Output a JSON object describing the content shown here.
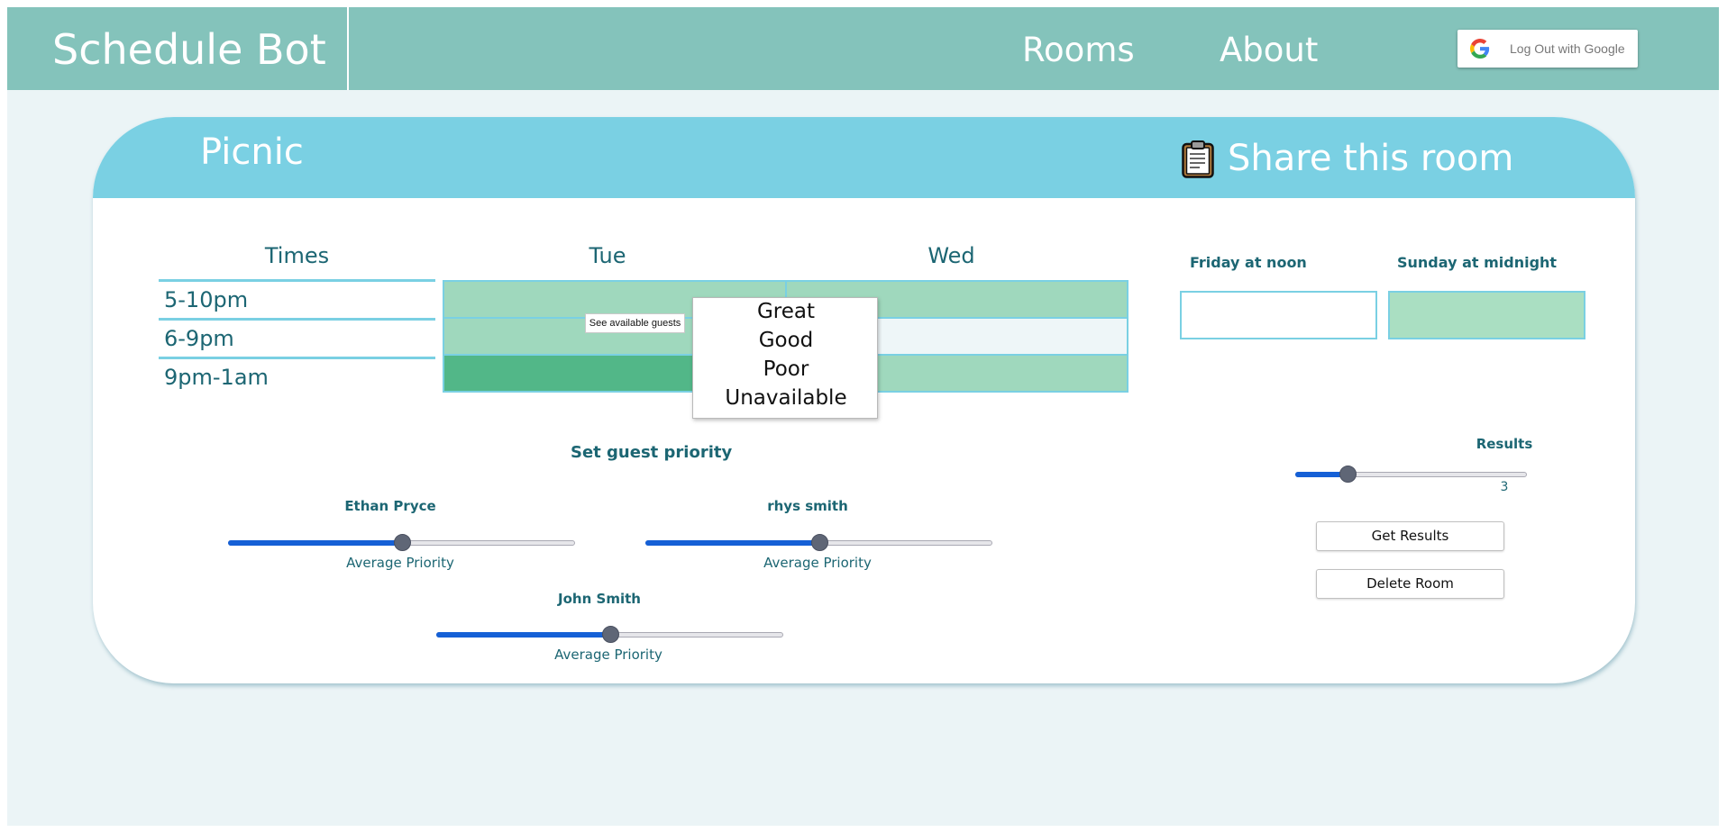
{
  "nav": {
    "brand": "Schedule Bot",
    "links": [
      "Rooms",
      "About"
    ],
    "google_button": "Log Out with Google"
  },
  "room": {
    "title": "Picnic",
    "share_label": "Share this room"
  },
  "schedule": {
    "columns": [
      "Times",
      "Tue",
      "Wed"
    ],
    "rows": [
      "5-10pm",
      "6-9pm",
      "9pm-1am"
    ],
    "cells": [
      [
        "good",
        "good"
      ],
      [
        "good",
        "none"
      ],
      [
        "great",
        "good"
      ]
    ],
    "tooltip": "See available guests",
    "menu_options": [
      "Great",
      "Good",
      "Poor",
      "Unavailable"
    ]
  },
  "side_options": [
    {
      "label": "Friday at noon",
      "status": "none"
    },
    {
      "label": "Sunday at midnight",
      "status": "good"
    }
  ],
  "priority": {
    "title": "Set guest priority",
    "guests": [
      {
        "name": "Ethan Pryce",
        "priority_label": "Average Priority",
        "level": 0.5
      },
      {
        "name": "rhys smith",
        "priority_label": "Average Priority",
        "level": 0.5
      },
      {
        "name": "John Smith",
        "priority_label": "Average Priority",
        "level": 0.5
      }
    ]
  },
  "results": {
    "title": "Results",
    "value": "3",
    "slider_min": 1,
    "slider_max": 10,
    "get_button": "Get Results",
    "delete_button": "Delete Room"
  },
  "colors": {
    "header": "#84c3bb",
    "card_header": "#7ad0e3",
    "great": "#52b788",
    "good": "#9fd8bd",
    "side_good": "#aadfc2",
    "empty_cell": "#eef6f8",
    "text": "#1c6673",
    "slider_fill": "#1560d6"
  }
}
